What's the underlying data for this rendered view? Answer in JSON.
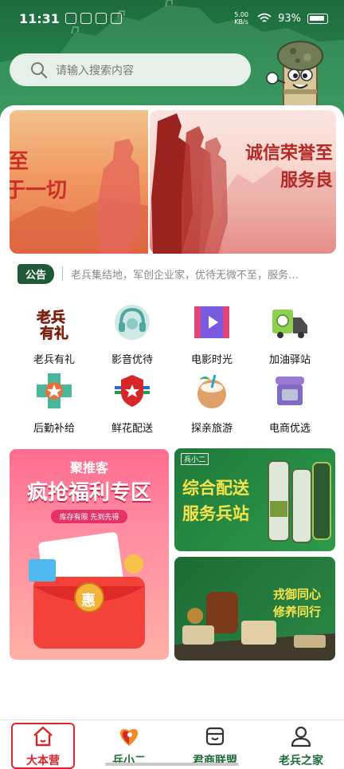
{
  "status_bar": {
    "time": "11:31",
    "network": "5.00 KB/s",
    "battery": "93%"
  },
  "search": {
    "placeholder": "请输入搜索内容"
  },
  "banner": {
    "left_text_line1": "至",
    "left_text_line2": "于一切",
    "right_text_line1": "诚信荣誉至",
    "right_text_line2": "服务良"
  },
  "notice": {
    "badge": "公告",
    "text": "老兵集结地，军创企业家，优待无微不至，服务…"
  },
  "grid": {
    "items": [
      {
        "label": "老兵有礼",
        "icon": "gift-text-icon"
      },
      {
        "label": "影音优待",
        "icon": "headset-icon"
      },
      {
        "label": "电影时光",
        "icon": "film-play-icon"
      },
      {
        "label": "加油驿站",
        "icon": "fuel-truck-icon"
      },
      {
        "label": "后勤补给",
        "icon": "supply-star-icon"
      },
      {
        "label": "鲜花配送",
        "icon": "shield-star-icon"
      },
      {
        "label": "探亲旅游",
        "icon": "coconut-icon"
      },
      {
        "label": "电商优选",
        "icon": "shop-icon"
      }
    ]
  },
  "promos": {
    "left": {
      "tag": "聚推客",
      "title": "疯抢福利专区",
      "subtitle": "库存有限 先到先得",
      "coupon": "惠"
    },
    "right_top": {
      "title_line1": "综合配送",
      "title_line2": "服务兵站",
      "brand": "兵小二"
    },
    "right_bottom": {
      "title_line1": "戎御同心",
      "title_line2": "修养同行"
    }
  },
  "bottom_nav": {
    "items": [
      {
        "label": "大本营",
        "active": true
      },
      {
        "label": "兵小二",
        "active": false
      },
      {
        "label": "君商联盟",
        "active": false
      },
      {
        "label": "老兵之家",
        "active": false
      }
    ]
  },
  "colors": {
    "primary_green": "#1f6b3b",
    "active_red": "#d7262a",
    "header_green": "#23804a"
  }
}
